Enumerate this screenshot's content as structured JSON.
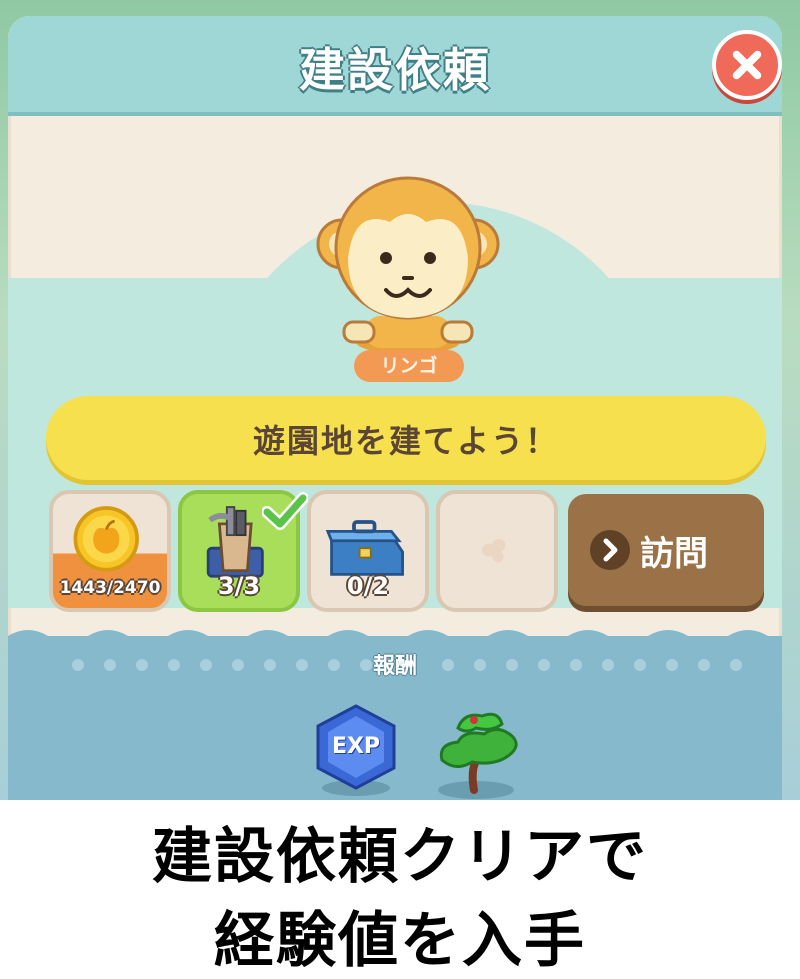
{
  "header": {
    "title": "建設依頼"
  },
  "npc": {
    "name": "リンゴ"
  },
  "quest": {
    "text": "遊園地を建てよう！"
  },
  "requirements": [
    {
      "icon": "apple-coin-icon",
      "progress_text": "1443/2470",
      "progress": 0.584,
      "completed": false
    },
    {
      "icon": "tool-bucket-icon",
      "progress_text": "3/3",
      "progress": 1.0,
      "completed": true
    },
    {
      "icon": "toolbox-icon",
      "progress_text": "0/2",
      "progress": 0.0,
      "completed": false
    },
    {
      "icon": "empty-slot-icon",
      "progress_text": "",
      "completed": false
    }
  ],
  "visit_button": {
    "label": "訪問"
  },
  "rewards": {
    "title": "報酬",
    "items": [
      {
        "icon": "exp-gem-icon",
        "label": "EXP"
      },
      {
        "icon": "bonsai-tree-icon"
      }
    ]
  },
  "caption": {
    "line1": "建設依頼クリアで",
    "line2": "経験値を入手"
  },
  "colors": {
    "header": "#9fd6d6",
    "banner": "#f7e04e",
    "completed_slot": "#a8de5a",
    "visit_button": "#9b7248",
    "close_button": "#f06a5a",
    "reward_area": "#86b9cc"
  }
}
